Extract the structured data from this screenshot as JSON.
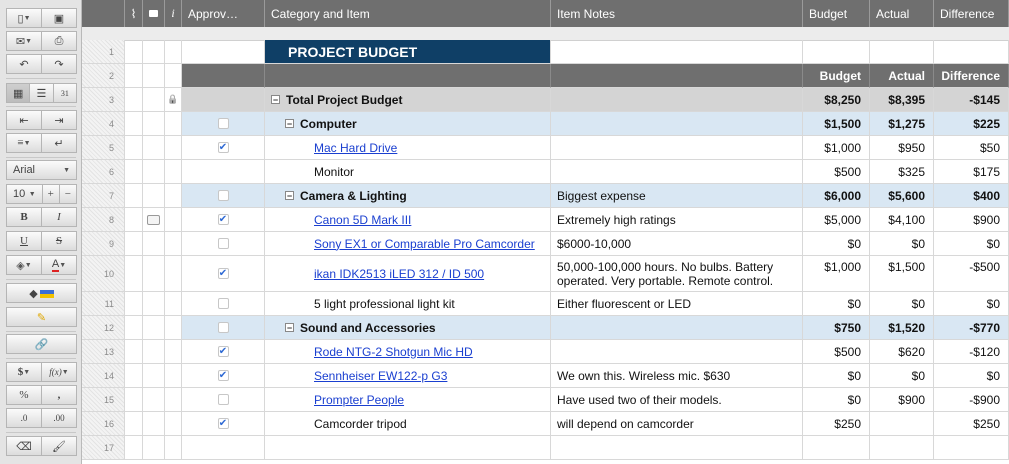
{
  "toolbar": {
    "font_name": "Arial",
    "font_size": "10",
    "bold_label": "B",
    "italic_label": "I",
    "underline_label": "U",
    "strike_label": "S",
    "currency_label": "$",
    "function_label": "f(x)",
    "percent_label": "%",
    "comma_label": ",",
    "dec_less_label": ".0",
    "dec_more_label": ".00",
    "plus_label": "+",
    "minus_label": "−",
    "calendar_label": "31",
    "text_color_label": "A"
  },
  "columns": {
    "approved": "Approv…",
    "category": "Category and Item",
    "notes": "Item Notes",
    "budget": "Budget",
    "actual": "Actual",
    "difference": "Difference"
  },
  "title": "PROJECT BUDGET",
  "subheader": {
    "budget": "Budget",
    "actual": "Actual",
    "difference": "Difference"
  },
  "rows": [
    {
      "num": "1"
    },
    {
      "num": "2"
    },
    {
      "num": "3",
      "item": "Total Project Budget",
      "notes": "",
      "budget": "$8,250",
      "actual": "$8,395",
      "difference": "-$145"
    },
    {
      "num": "4",
      "item": "Computer",
      "notes": "",
      "budget": "$1,500",
      "actual": "$1,275",
      "difference": "$225"
    },
    {
      "num": "5",
      "item": "Mac Hard Drive",
      "notes": "",
      "budget": "$1,000",
      "actual": "$950",
      "difference": "$50"
    },
    {
      "num": "6",
      "item": "Monitor",
      "notes": "",
      "budget": "$500",
      "actual": "$325",
      "difference": "$175"
    },
    {
      "num": "7",
      "item": "Camera & Lighting",
      "notes": "Biggest expense",
      "budget": "$6,000",
      "actual": "$5,600",
      "difference": "$400"
    },
    {
      "num": "8",
      "item": "Canon 5D Mark III",
      "notes": "Extremely high ratings",
      "budget": "$5,000",
      "actual": "$4,100",
      "difference": "$900"
    },
    {
      "num": "9",
      "item": "Sony EX1 or Comparable Pro Camcorder",
      "notes": "$6000-10,000",
      "budget": "$0",
      "actual": "$0",
      "difference": "$0"
    },
    {
      "num": "10",
      "item": "ikan IDK2513 iLED 312 / ID 500",
      "notes": "50,000-100,000 hours. No bulbs. Battery",
      "notes2": "operated. Very portable. Remote control.",
      "budget": "$1,000",
      "actual": "$1,500",
      "difference": "-$500"
    },
    {
      "num": "11",
      "item": "5 light professional light kit",
      "notes": "Either fluorescent or LED",
      "budget": "$0",
      "actual": "$0",
      "difference": "$0"
    },
    {
      "num": "12",
      "item": "Sound and Accessories",
      "notes": "",
      "budget": "$750",
      "actual": "$1,520",
      "difference": "-$770"
    },
    {
      "num": "13",
      "item": "Rode NTG-2 Shotgun Mic HD",
      "notes": "",
      "budget": "$500",
      "actual": "$620",
      "difference": "-$120"
    },
    {
      "num": "14",
      "item": "Sennheiser EW122-p G3",
      "notes": "We own this. Wireless mic. $630",
      "budget": "$0",
      "actual": "$0",
      "difference": "$0"
    },
    {
      "num": "15",
      "item": "Prompter People",
      "notes": "Have used two of their models.",
      "budget": "$0",
      "actual": "$900",
      "difference": "-$900"
    },
    {
      "num": "16",
      "item": "Camcorder tripod",
      "notes": "will depend on camcorder",
      "budget": "$250",
      "actual": "",
      "difference": "$250"
    },
    {
      "num": "17"
    }
  ],
  "colors": {
    "title_bg": "#0f3f66",
    "section_header_bg": "#6f6f6f",
    "total_row_bg": "#d4d4d4",
    "group_row_bg": "#d9e7f3",
    "link": "#1a3fd0",
    "check": "#2f6ad4"
  }
}
